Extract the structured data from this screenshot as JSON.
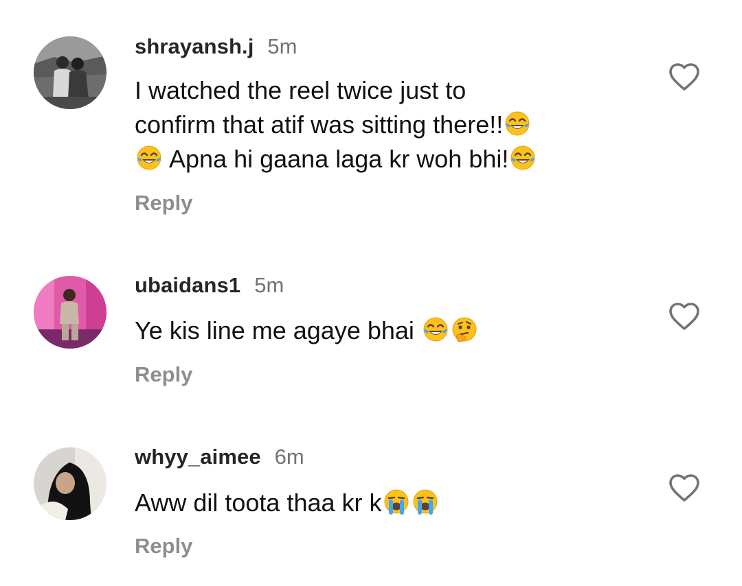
{
  "comments": [
    {
      "username": "shrayansh.j",
      "time": "5m",
      "text_lines": [
        "I watched the reel twice just to",
        "confirm that atif was sitting there!!",
        " Apna hi gaana laga kr woh bhi!"
      ],
      "emojis": [
        "face-with-tears-of-joy",
        "face-with-tears-of-joy",
        "face-with-tears-of-joy"
      ],
      "reply_label": "Reply",
      "avatar_style": "grayscale photo of two people"
    },
    {
      "username": "ubaidans1",
      "time": "5m",
      "text_lines": [
        "Ye kis line me agaye bhai "
      ],
      "emojis": [
        "face-with-tears-of-joy",
        "thinking-face"
      ],
      "reply_label": "Reply",
      "avatar_style": "person on pink stage"
    },
    {
      "username": "whyy_aimee",
      "time": "6m",
      "text_lines": [
        "Aww dil toota thaa kr k"
      ],
      "emojis": [
        "loudly-crying-face",
        "loudly-crying-face"
      ],
      "reply_label": "Reply",
      "avatar_style": "person in black hijab covering face"
    }
  ],
  "colors": {
    "username": "#262626",
    "time": "#737373",
    "reply": "#8e8e8e",
    "heart_outline": "#737373"
  },
  "icons": {
    "like": "heart-outline-icon"
  }
}
